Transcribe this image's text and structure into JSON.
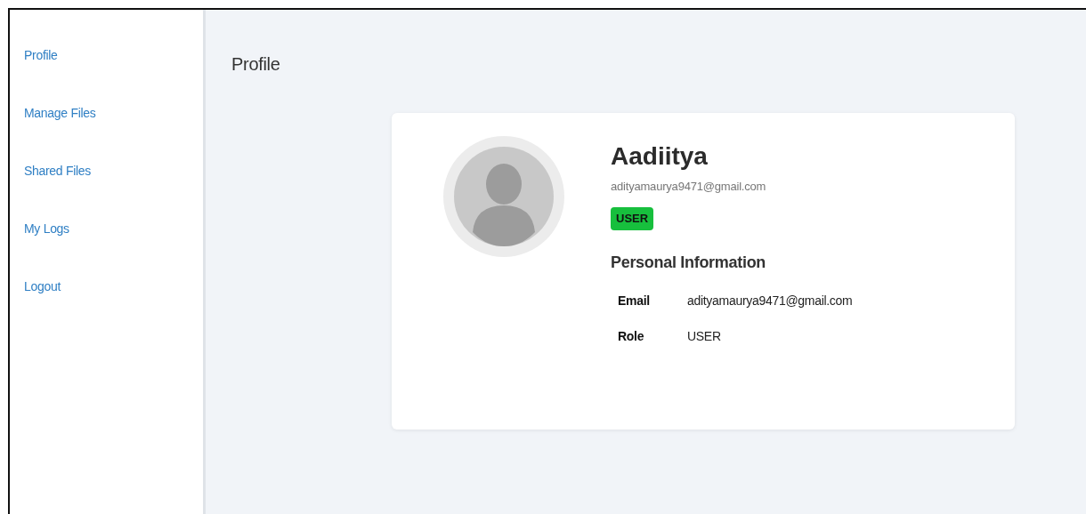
{
  "sidebar": {
    "items": [
      {
        "label": "Profile"
      },
      {
        "label": "Manage Files"
      },
      {
        "label": "Shared Files"
      },
      {
        "label": "My Logs"
      },
      {
        "label": "Logout"
      }
    ]
  },
  "page_title": "Profile",
  "profile": {
    "name": "Aadiitya",
    "email": "adityamaurya9471@gmail.com",
    "role_badge": "USER",
    "section_title": "Personal Information",
    "details": [
      {
        "label": "Email",
        "value": "adityamaurya9471@gmail.com"
      },
      {
        "label": "Role",
        "value": "USER"
      }
    ]
  }
}
